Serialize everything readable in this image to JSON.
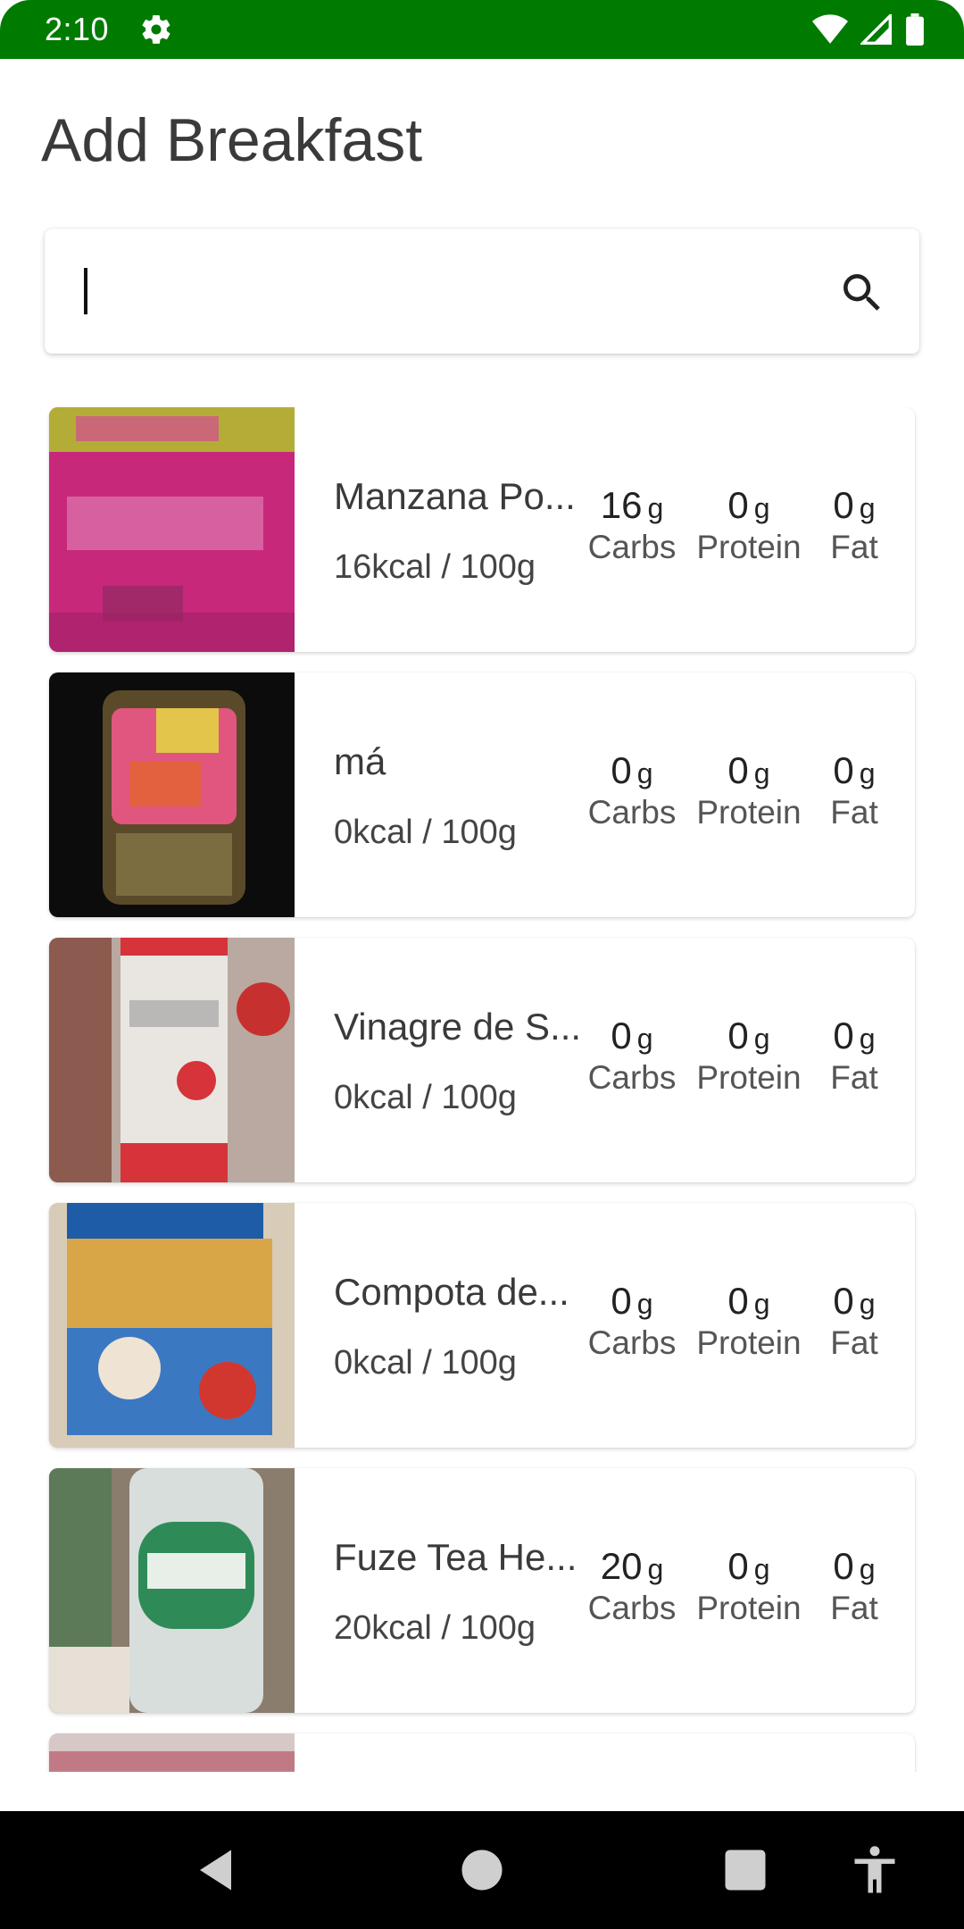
{
  "status_bar": {
    "time": "2:10",
    "color": "#007b00"
  },
  "page": {
    "title": "Add Breakfast"
  },
  "search": {
    "value": "",
    "placeholder": ""
  },
  "items": [
    {
      "name": "Manzana Po...",
      "kcal": "16kcal / 100g",
      "carbs": "16",
      "protein": "0",
      "fat": "0"
    },
    {
      "name": "má",
      "kcal": "0kcal / 100g",
      "carbs": "0",
      "protein": "0",
      "fat": "0"
    },
    {
      "name": "Vinagre de S...",
      "kcal": "0kcal / 100g",
      "carbs": "0",
      "protein": "0",
      "fat": "0"
    },
    {
      "name": "Compota de...",
      "kcal": "0kcal / 100g",
      "carbs": "0",
      "protein": "0",
      "fat": "0"
    },
    {
      "name": "Fuze Tea He...",
      "kcal": "20kcal / 100g",
      "carbs": "20",
      "protein": "0",
      "fat": "0"
    }
  ],
  "labels": {
    "unit": "g",
    "carbs": "Carbs",
    "protein": "Protein",
    "fat": "Fat"
  },
  "icons": {
    "status": [
      "gear-icon",
      "wifi-icon",
      "signal-icon",
      "battery-icon"
    ],
    "search": "search-icon",
    "nav": [
      "back-icon",
      "home-icon",
      "recents-icon",
      "accessibility-icon"
    ]
  }
}
